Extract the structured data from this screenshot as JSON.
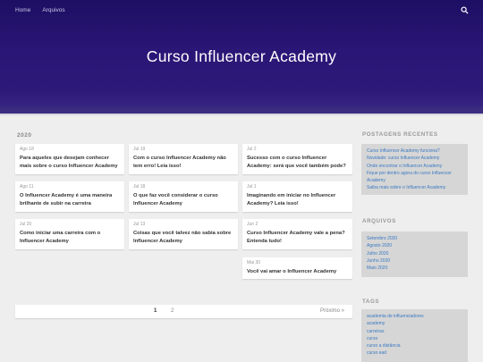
{
  "nav": {
    "items": [
      "Home",
      "Arquivos"
    ],
    "search_icon": "search-icon"
  },
  "site": {
    "title": "Curso Influencer Academy"
  },
  "archive": {
    "year": "2020",
    "posts": [
      {
        "date": "Ago 18",
        "title": "Para aqueles que desejam conhecer mais sobre o curso Influencer Academy"
      },
      {
        "date": "Jul 19",
        "title": "Com o curso Influencer Academy não tem erro! Leia isso!"
      },
      {
        "date": "Jul 2",
        "title": "Sucesso com o curso Influencer Academy: será que você também pode?"
      },
      {
        "date": "Ago 11",
        "title": "O Influencer Academy é uma maneira brilhante de subir na carreira"
      },
      {
        "date": "Jul 18",
        "title": "O que faz você considerar o curso Influencer Academy"
      },
      {
        "date": "Jul 1",
        "title": "Imaginando em iniciar no Influencer Academy? Leia isso!"
      },
      {
        "date": "Jul 20",
        "title": "Como iniciar uma carreira com o Influencer Academy"
      },
      {
        "date": "Jul 13",
        "title": "Coisas que você talvez não sabia sobre Influencer Academy"
      },
      {
        "date": "Jun 2",
        "title": "Curso Influencer Academy vale a pena? Entenda tudo!"
      },
      {
        "date": "Mai 30",
        "title": "Você vai amar o Influencer Academy"
      }
    ]
  },
  "pagination": {
    "page1": "1",
    "page2": "2",
    "next": "Próximo »"
  },
  "sidebar": {
    "recent": {
      "heading": "POSTAGENS RECENTES",
      "links": [
        "Curso Influencer Academy funciona?",
        "Novidade: curso Influencer Academy",
        "Onde encontrar o Influencer Academy",
        "Fique por dentro agora do curso Influencer Academy",
        "Saiba mais sobre o Influencer Academy"
      ]
    },
    "archives": {
      "heading": "ARQUIVOS",
      "links": [
        "Setembro 2020",
        "Agosto 2020",
        "Julho 2020",
        "Junho 2020",
        "Maio 2020"
      ]
    },
    "tags": {
      "heading": "TAGS",
      "links": [
        "academia de influenciadores",
        "academy",
        "carreiras",
        "curso",
        "curso a distância",
        "curso ead"
      ]
    }
  },
  "colors": {
    "hero": "#2a1676",
    "link": "#3a79c2",
    "background": "#eeeeee"
  }
}
